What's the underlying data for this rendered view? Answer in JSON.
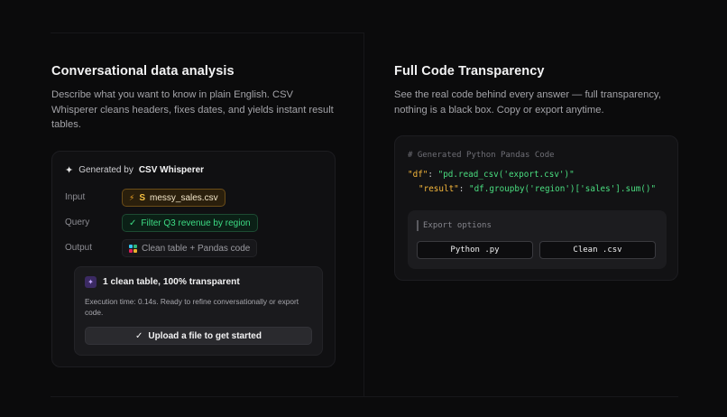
{
  "left": {
    "title": "Conversational data analysis",
    "description": "Describe what you want to know in plain English. CSV Whisperer cleans headers, fixes dates, and yields instant result tables.",
    "card": {
      "generated_prefix": "Generated by",
      "generated_brand": "CSV Whisperer",
      "rows": {
        "input_label": "Input",
        "input_badge": "S",
        "input_value": "messy_sales.csv",
        "query_label": "Query",
        "query_value": "Filter Q3 revenue by region",
        "output_label": "Output",
        "output_value": "Clean table + Pandas code"
      },
      "result": {
        "title": "1 clean table, 100% transparent",
        "description": "Execution time: 0.14s. Ready to refine conversationally or export code.",
        "button": "Upload a file to get started"
      }
    }
  },
  "right": {
    "title": "Full Code Transparency",
    "description": "See the real code behind every answer — full transparency, nothing is a black box. Copy or export anytime.",
    "code": {
      "comment": "# Generated Python Pandas Code",
      "line1_key": "\"df\"",
      "line1_sep": ": ",
      "line1_val": "\"pd.read_csv('export.csv')\"",
      "line2_key": "\"result\"",
      "line2_sep": ": ",
      "line2_val": "\"df.groupby('region')['sales'].sum()\""
    },
    "export": {
      "label": "Export options",
      "python_button": "Python .py",
      "csv_button": "Clean .csv"
    }
  },
  "colors": {
    "background": "#0b0b0c",
    "accent_green": "#3ddc84",
    "accent_amber": "#f5a623",
    "accent_purple": "#c4a8ff"
  },
  "icons": [
    "sparkle-icon",
    "bolt-icon",
    "check-icon",
    "grid-color-icon",
    "sparkle-badge-icon",
    "check-icon"
  ]
}
